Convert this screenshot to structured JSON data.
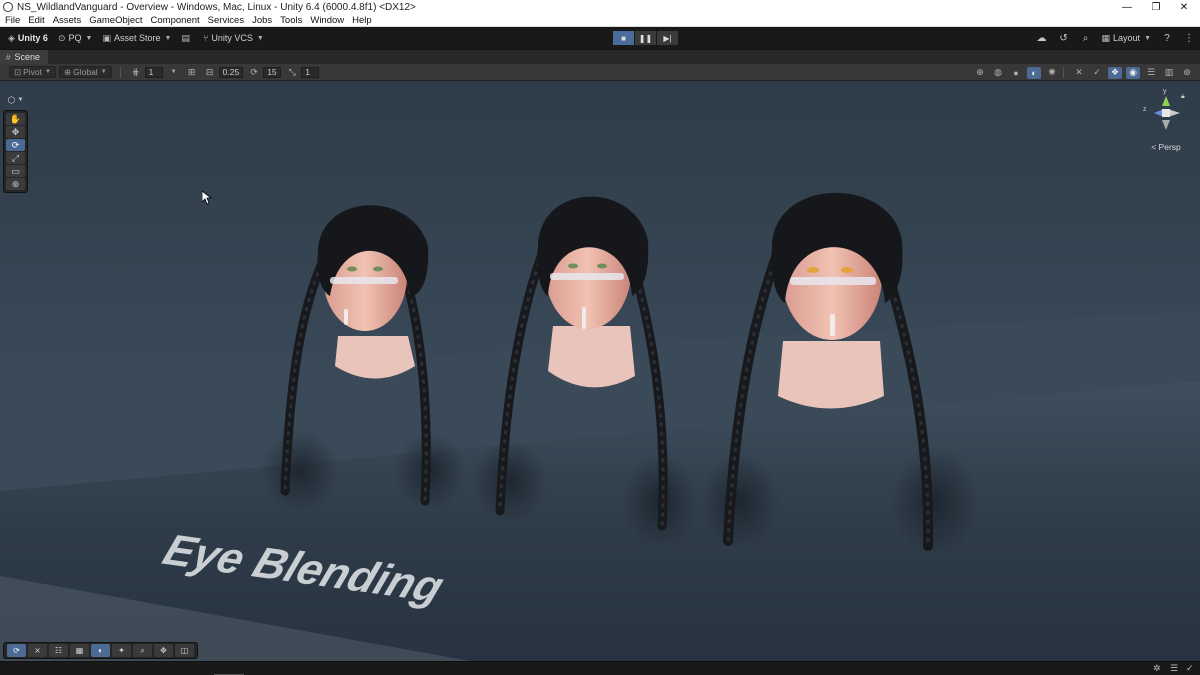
{
  "window": {
    "title": "NS_WildlandVanguard - Overview - Windows, Mac, Linux - Unity 6.4 (6000.4.8f1) <DX12>",
    "minimize_glyph": "—",
    "maximize_glyph": "❐",
    "close_glyph": "✕"
  },
  "menu": [
    "File",
    "Edit",
    "Assets",
    "GameObject",
    "Component",
    "Services",
    "Jobs",
    "Tools",
    "Window",
    "Help"
  ],
  "main_toolbar": {
    "account": "Unity 6",
    "org": "PQ",
    "asset_store": "Asset Store",
    "vcs": "Unity VCS",
    "layout": "Layout",
    "play_state": "playing"
  },
  "scene_tab": {
    "label": "Scene"
  },
  "scene_toolbar": {
    "pivot": "Pivot",
    "global": "Global",
    "grid_snap_value": "1",
    "increment_snap": "0.25",
    "rotation_snap": "15",
    "scale_snap": "1"
  },
  "gizmo": {
    "mode_label": "< Persp",
    "y_label": "y",
    "z_label": "z"
  },
  "viewport": {
    "floor_text": "Eye Blending",
    "accent_color": "#4a6a94",
    "heads": [
      "head-left",
      "head-center",
      "head-right"
    ]
  }
}
